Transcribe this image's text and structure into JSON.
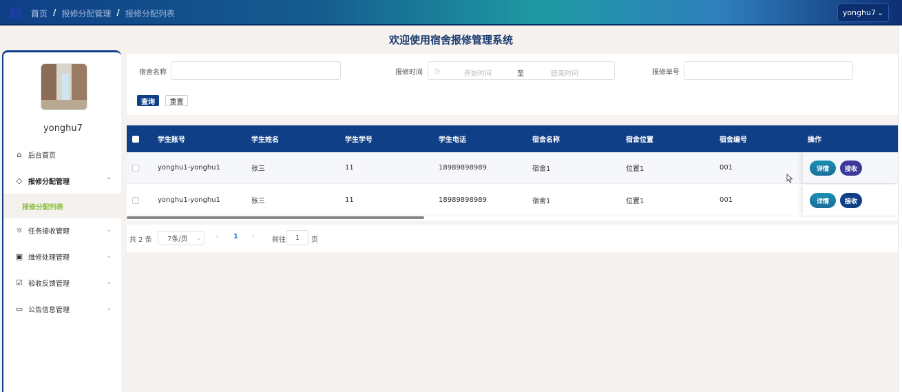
{
  "topbar": {
    "breadcrumb": [
      "首页",
      "报修分配管理",
      "报修分配列表"
    ],
    "breadcrumb_sep": "/",
    "user_label": "yonghu7",
    "user_chevron": "⌄"
  },
  "page_title": "欢迎使用宿舍报修管理系统",
  "sidebar": {
    "username": "yonghu7",
    "items": [
      {
        "label": "后台首页",
        "icon": "home-icon",
        "glyph": "⌂"
      },
      {
        "label": "报修分配管理",
        "icon": "tag-icon",
        "glyph": "◇",
        "expanded": true,
        "chevron": "^"
      },
      {
        "label": "任务接收管理",
        "icon": "sun-icon",
        "glyph": "☼",
        "chevron": "⌄"
      },
      {
        "label": "维修处理管理",
        "icon": "inbox-icon",
        "glyph": "▣",
        "chevron": "⌄"
      },
      {
        "label": "验收反馈管理",
        "icon": "clipboard-icon",
        "glyph": "☑",
        "chevron": "⌄"
      },
      {
        "label": "公告信息管理",
        "icon": "message-icon",
        "glyph": "▭",
        "chevron": "⌄"
      }
    ],
    "submenu_active": "报修分配列表"
  },
  "search": {
    "dorm_name_label": "宿舍名称",
    "repair_time_label": "报修时间",
    "start_placeholder": "开始时间",
    "range_sep": "至",
    "end_placeholder": "结束时间",
    "repair_no_label": "报修单号",
    "query_label": "查询",
    "reset_label": "重置",
    "clock_glyph": "◷"
  },
  "table": {
    "headers": [
      "学生账号",
      "学生姓名",
      "学生学号",
      "学生电话",
      "宿舍名称",
      "宿舍位置",
      "宿舍编号",
      "操作"
    ],
    "rows": [
      {
        "account": "yonghu1-yonghu1",
        "name": "张三",
        "number": "11",
        "phone": "18989898989",
        "dorm": "宿舍1",
        "location": "位置1",
        "dorm_no": "001"
      },
      {
        "account": "yonghu1-yonghu1",
        "name": "张三",
        "number": "11",
        "phone": "18989898989",
        "dorm": "宿舍1",
        "location": "位置1",
        "dorm_no": "001"
      }
    ],
    "detail_label": "详情",
    "accept_label": "接收"
  },
  "pager": {
    "total": "共 2 条",
    "page_size": "7条/页",
    "dropdown_glyph": "⌄",
    "prev_glyph": "‹",
    "current_page": "1",
    "next_glyph": "›",
    "goto_label": "前往",
    "goto_value": "1",
    "page_unit": "页"
  },
  "colors": {
    "primary": "#0f3f86",
    "accent_green": "#8bbf3c",
    "link_blue": "#1a7ed8"
  }
}
